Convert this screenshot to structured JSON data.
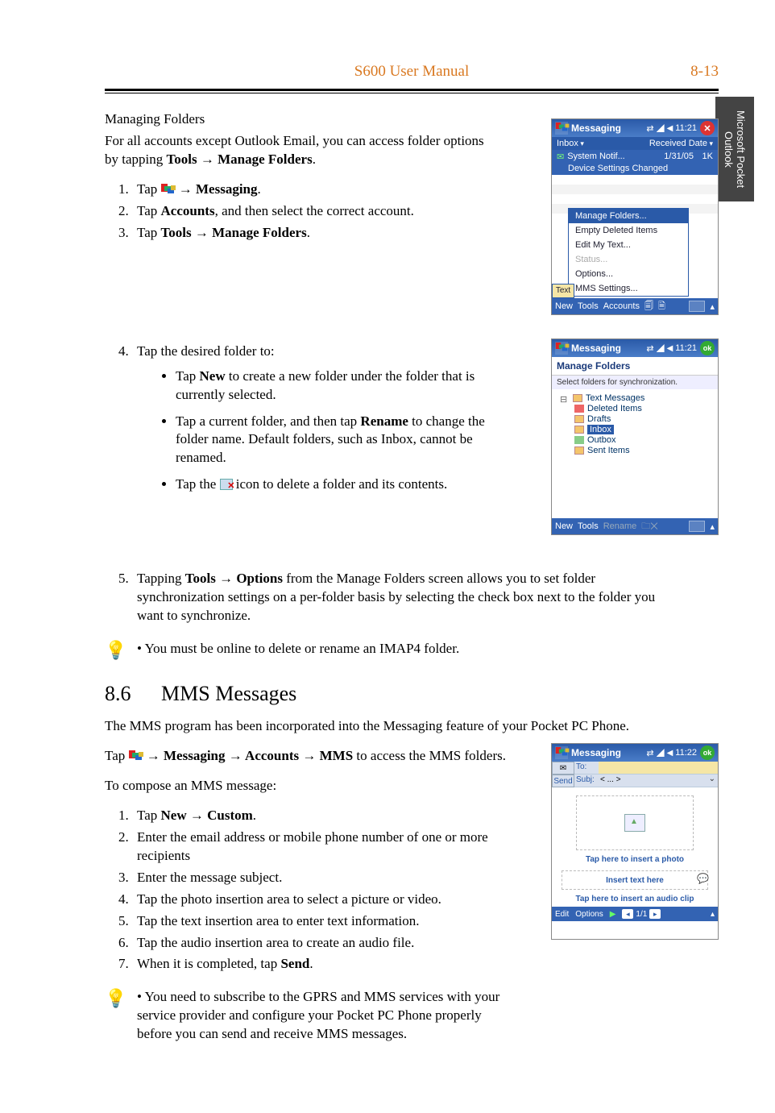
{
  "header": {
    "title": "S600 User Manual",
    "page": "8-13"
  },
  "sidetab": "Microsoft Pocket Outlook",
  "sec1": {
    "heading": "Managing Folders",
    "intro_a": "For all accounts except Outlook Email, you can access folder options by tapping ",
    "intro_b": "Tools → Manage Folders",
    "step1_a": "Tap ",
    "step1_b": " → ",
    "step1_c": "Messaging",
    "step1_d": ".",
    "step2_a": "Tap ",
    "step2_b": "Accounts",
    "step2_c": ", and then select the correct account.",
    "step3_a": "Tap ",
    "step3_b": "Tools → Manage Folders",
    "step3_c": ".",
    "step4": "Tap the desired folder to:",
    "b1_a": "Tap ",
    "b1_b": "New",
    "b1_c": " to create a new folder under the folder that is currently selected.",
    "b2_a": "Tap a current folder, and then tap ",
    "b2_b": "Rename",
    "b2_c": " to change the folder name. Default folders, such as Inbox, cannot be renamed.",
    "b3_a": "Tap the ",
    "b3_c": " icon to delete a folder and its contents.",
    "step5_a": "Tapping ",
    "step5_b": "Tools → Options",
    "step5_c": " from the Manage Folders screen allows you to set folder synchronization settings on a per-folder basis by selecting the check box next to the folder you want to synchronize.",
    "tip": "You must be online to delete or rename an IMAP4 folder."
  },
  "sec2": {
    "num": "8.6",
    "title": "MMS Messages",
    "p1": "The MMS program has been incorporated into the Messaging feature of your Pocket PC Phone.",
    "p2_a": "Tap ",
    "p2_b": " → ",
    "p2_c": "Messaging → Accounts → MMS",
    "p2_d": " to access the MMS folders.",
    "p3": "To compose an MMS message:",
    "s1_a": "Tap ",
    "s1_b": "New → Custom",
    "s1_c": ".",
    "s2": "Enter the email address or mobile phone number of one or more recipients",
    "s3": "Enter the message subject.",
    "s4": "Tap the photo insertion area to select a picture or video.",
    "s5": "Tap the text insertion area to enter text information.",
    "s6": "Tap the audio insertion area to create an audio file.",
    "s7_a": "When it is completed, tap ",
    "s7_b": "Send",
    "s7_c": ".",
    "tip": "You need to subscribe to the GPRS and MMS services with your service provider and configure your Pocket PC Phone properly before you can send and receive MMS messages."
  },
  "shot1": {
    "title": "Messaging",
    "time": "11:21",
    "sub_left": "Inbox",
    "sub_right": "Received Date",
    "row1_a": "System Notif...",
    "row1_b": "1/31/05",
    "row1_c": "1K",
    "row2": "Device Settings Changed",
    "menu": [
      "Manage Folders...",
      "Empty Deleted Items",
      "Edit My Text...",
      "Status...",
      "Options...",
      "MMS Settings..."
    ],
    "side_label": "Text",
    "bb": [
      "New",
      "Tools",
      "Accounts"
    ]
  },
  "shot2": {
    "title": "Messaging",
    "time": "11:21",
    "head": "Manage Folders",
    "sub": "Select folders for synchronization.",
    "tree": {
      "root": "Text Messages",
      "items": [
        "Deleted Items",
        "Drafts",
        "Inbox",
        "Outbox",
        "Sent Items"
      ]
    },
    "bb": [
      "New",
      "Tools",
      "Rename"
    ]
  },
  "shot3": {
    "title": "Messaging",
    "time": "11:22",
    "send": "Send",
    "to_label": "To:",
    "to_val": "",
    "subj_label": "Subj:",
    "subj_val": "< ... >",
    "photo_label": "Tap here to insert a photo",
    "text_label": "Insert text here",
    "audio_label": "Tap here to insert an audio clip",
    "bb_left": [
      "Edit",
      "Options"
    ],
    "page": "1/1"
  }
}
